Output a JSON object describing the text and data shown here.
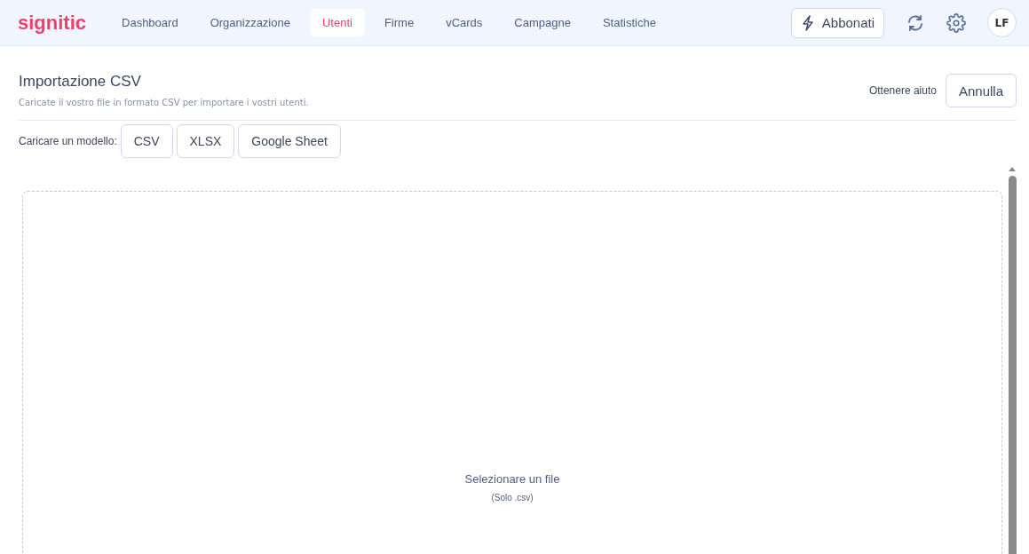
{
  "logo": "signitic",
  "nav": [
    {
      "label": "Dashboard",
      "selected": false
    },
    {
      "label": "Organizzazione",
      "selected": false
    },
    {
      "label": "Utenti",
      "selected": true
    },
    {
      "label": "Firme",
      "selected": false
    },
    {
      "label": "vCards",
      "selected": false
    },
    {
      "label": "Campagne",
      "selected": false
    },
    {
      "label": "Statistiche",
      "selected": false
    }
  ],
  "subscribe_button": "Abbonati",
  "avatar": "LF",
  "page": {
    "title": "Importazione CSV",
    "subtitle": "Caricate il vostro file in formato CSV per importare i vostri utenti.",
    "help_link": "Ottenere aiuto",
    "cancel_button": "Annulla"
  },
  "template": {
    "label": "Caricare un modello:",
    "buttons": [
      "CSV",
      "XLSX",
      "Google Sheet"
    ]
  },
  "dropzone": {
    "title": "Selezionare un file",
    "hint": "(Solo .csv)"
  }
}
